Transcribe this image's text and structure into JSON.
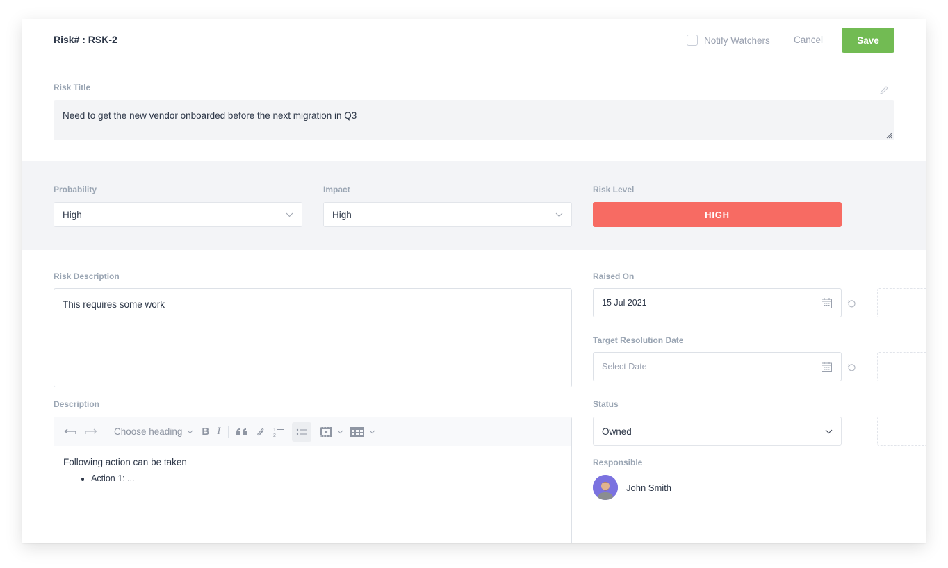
{
  "header": {
    "title": "Risk# : RSK-2",
    "notify_watchers_label": "Notify Watchers",
    "notify_watchers_checked": false,
    "cancel_label": "Cancel",
    "save_label": "Save"
  },
  "risk_title": {
    "label": "Risk Title",
    "value": "Need to get the new vendor onboarded before the next migration in Q3"
  },
  "assessment": {
    "probability": {
      "label": "Probability",
      "value": "High"
    },
    "impact": {
      "label": "Impact",
      "value": "High"
    },
    "risk_level": {
      "label": "Risk Level",
      "value": "HIGH",
      "color": "#f76b63"
    }
  },
  "risk_description": {
    "label": "Risk Description",
    "value": "This requires some work"
  },
  "dates": {
    "raised_on": {
      "label": "Raised On",
      "value": "15 Jul 2021"
    },
    "target_resolution": {
      "label": "Target Resolution Date",
      "placeholder": "Select Date"
    }
  },
  "status": {
    "label": "Status",
    "value": "Owned"
  },
  "responsible": {
    "label": "Responsible",
    "name": "John Smith"
  },
  "description": {
    "label": "Description",
    "toolbar": {
      "heading_label": "Choose heading",
      "icons": [
        "undo-icon",
        "redo-icon",
        "bold-icon",
        "italic-icon",
        "blockquote-icon",
        "attachment-icon",
        "numbered-list-icon",
        "bulleted-list-icon",
        "media-icon",
        "table-icon"
      ]
    },
    "content": {
      "paragraph": "Following action can be taken",
      "bullets": [
        "Action 1: ..."
      ]
    }
  },
  "colors": {
    "save": "#72bb53",
    "risk_high": "#f76b63",
    "band": "#f3f4f7"
  }
}
